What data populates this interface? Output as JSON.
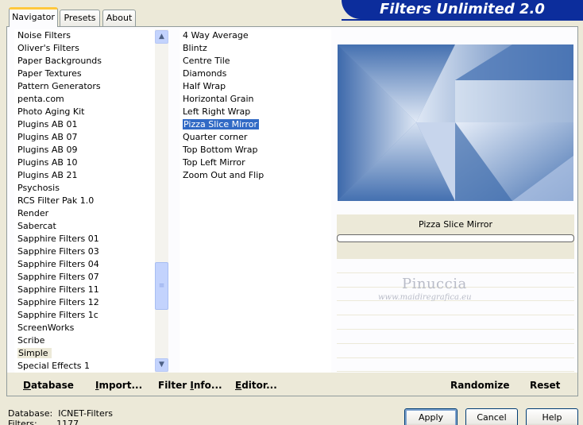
{
  "tabs": [
    {
      "label": "Navigator",
      "active": true
    },
    {
      "label": "Presets",
      "active": false
    },
    {
      "label": "About",
      "active": false
    }
  ],
  "title": "Filters Unlimited 2.0",
  "categories": [
    "Noise Filters",
    "Oliver's Filters",
    "Paper Backgrounds",
    "Paper Textures",
    "Pattern Generators",
    "penta.com",
    "Photo Aging Kit",
    "Plugins AB 01",
    "Plugins AB 07",
    "Plugins AB 09",
    "Plugins AB 10",
    "Plugins AB 21",
    "Psychosis",
    "RCS Filter Pak 1.0",
    "Render",
    "Sabercat",
    "Sapphire Filters 01",
    "Sapphire Filters 03",
    "Sapphire Filters 04",
    "Sapphire Filters 07",
    "Sapphire Filters 11",
    "Sapphire Filters 12",
    "Sapphire Filters 1c",
    "ScreenWorks",
    "Scribe",
    "Simple",
    "Special Effects 1"
  ],
  "selected_category": "Simple",
  "filters": [
    "4 Way Average",
    "Blintz",
    "Centre Tile",
    "Diamonds",
    "Half Wrap",
    "Horizontal Grain",
    "Left Right Wrap",
    "Pizza Slice Mirror",
    "Quarter corner",
    "Top Bottom Wrap",
    "Top Left Mirror",
    "Zoom Out and Flip"
  ],
  "selected_filter": "Pizza Slice Mirror",
  "preview": {
    "filter_name": "Pizza Slice Mirror",
    "progress": 0
  },
  "watermark": {
    "line1": "Pinuccia",
    "line2": "www.maidiregrafica.eu"
  },
  "bottom_buttons": {
    "database": {
      "u": "D",
      "rest": "atabase"
    },
    "import": {
      "u": "I",
      "rest": "mport..."
    },
    "filter_info": {
      "pre": "Filter ",
      "u": "I",
      "rest": "nfo..."
    },
    "editor": {
      "u": "E",
      "rest": "ditor..."
    },
    "randomize": "Randomize",
    "reset": "Reset"
  },
  "status": {
    "database_label": "Database:",
    "database_value": "ICNET-Filters",
    "filters_label": "Filters:",
    "filters_value": "1177"
  },
  "dialog_buttons": {
    "apply": "Apply",
    "cancel": "Cancel",
    "help": "Help"
  },
  "colors": {
    "accent": "#0c2d9c",
    "selection": "#316ac5",
    "preview_blue": "#3f6cad"
  }
}
